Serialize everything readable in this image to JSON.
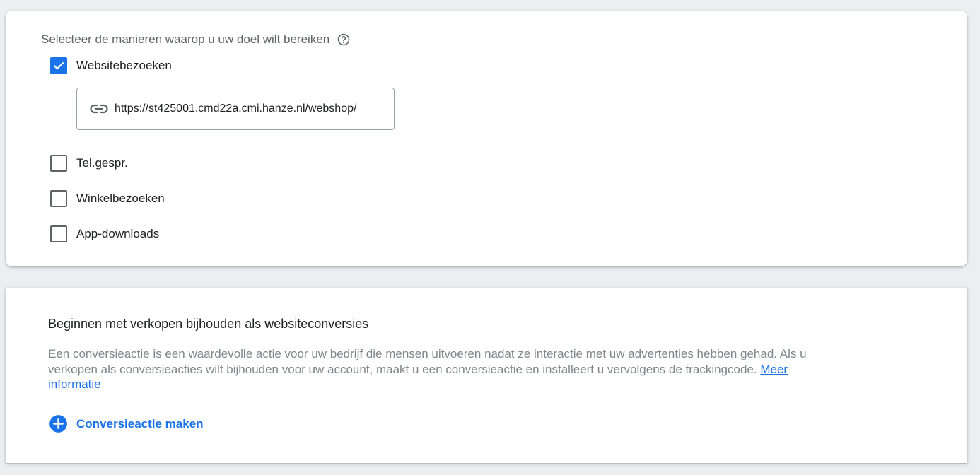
{
  "goal_section": {
    "heading": "Selecteer de manieren waarop u uw doel wilt bereiken",
    "help_icon": "help-circle-icon",
    "options": [
      {
        "label": "Websitebezoeken",
        "checked": true
      },
      {
        "label": "Tel.gespr.",
        "checked": false
      },
      {
        "label": "Winkelbezoeken",
        "checked": false
      },
      {
        "label": "App-downloads",
        "checked": false
      }
    ],
    "website_url": {
      "icon": "link-icon",
      "value": "https://st425001.cmd22a.cmi.hanze.nl/webshop/"
    }
  },
  "conversion_section": {
    "title": "Beginnen met verkopen bijhouden als websiteconversies",
    "description": "Een conversieactie is een waardevolle actie voor uw bedrijf die mensen uitvoeren nadat ze interactie met uw advertenties hebben gehad. Als u verkopen als conversieacties wilt bijhouden voor uw account, maakt u een conversieactie en installeert u vervolgens de trackingcode.",
    "learn_more_link": "Meer informatie",
    "create_button": {
      "icon": "add-circle-icon",
      "label": "Conversieactie maken"
    }
  },
  "colors": {
    "accent": "#1a73e8",
    "page_background": "#eceef1",
    "muted_text": "#80868b"
  }
}
